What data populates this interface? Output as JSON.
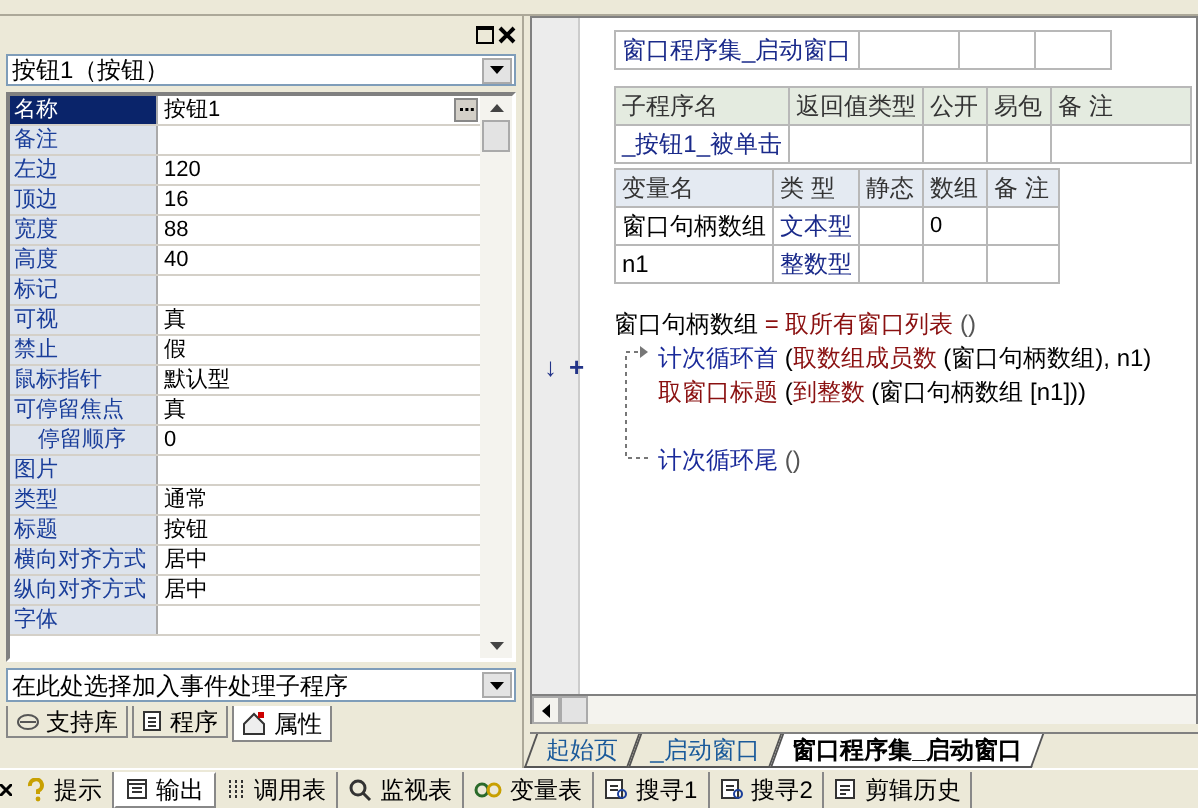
{
  "object_selector": {
    "value": "按钮1（按钮）"
  },
  "properties": [
    {
      "name": "名称",
      "value": "按钮1",
      "selected": true,
      "indented": false
    },
    {
      "name": "备注",
      "selected": false,
      "indented": false
    },
    {
      "name": "左边",
      "value": "120",
      "selected": false,
      "indented": false
    },
    {
      "name": "顶边",
      "value": "16",
      "selected": false,
      "indented": false
    },
    {
      "name": "宽度",
      "value": "88",
      "selected": false,
      "indented": false
    },
    {
      "name": "高度",
      "value": "40",
      "selected": false,
      "indented": false
    },
    {
      "name": "标记",
      "selected": false,
      "indented": false
    },
    {
      "name": "可视",
      "value": "真",
      "selected": false,
      "indented": false
    },
    {
      "name": "禁止",
      "value": "假",
      "selected": false,
      "indented": false
    },
    {
      "name": "鼠标指针",
      "value": "默认型",
      "selected": false,
      "indented": false
    },
    {
      "name": "可停留焦点",
      "value": "真",
      "selected": false,
      "indented": false
    },
    {
      "name": "停留顺序",
      "value": "0",
      "selected": false,
      "indented": true
    },
    {
      "name": "图片",
      "selected": false,
      "indented": false
    },
    {
      "name": "类型",
      "value": "通常",
      "selected": false,
      "indented": false
    },
    {
      "name": "标题",
      "value": "按钮",
      "selected": false,
      "indented": false
    },
    {
      "name": "横向对齐方式",
      "value": "居中",
      "selected": false,
      "indented": false
    },
    {
      "name": "纵向对齐方式",
      "value": "居中",
      "selected": false,
      "indented": false
    },
    {
      "name": "字体",
      "selected": false,
      "indented": false
    }
  ],
  "event_selector": {
    "value": "在此处选择加入事件处理子程序"
  },
  "panel_tabs": [
    {
      "label": "支持库",
      "selected": false
    },
    {
      "label": "程序",
      "selected": false
    },
    {
      "label": "属性",
      "selected": true
    }
  ],
  "assembly_table": {
    "name": "窗口程序集_启动窗口"
  },
  "sub_table": {
    "columns": [
      "子程序名",
      "返回值类型",
      "公开",
      "易包",
      "备 注"
    ],
    "rows": [
      [
        "_按钮1_被单击",
        "",
        "",
        "",
        ""
      ]
    ]
  },
  "var_table": {
    "columns": [
      "变量名",
      "类 型",
      "静态",
      "数组",
      "备 注"
    ],
    "rows": [
      [
        "窗口句柄数组",
        "文本型",
        "",
        "0",
        ""
      ],
      [
        "n1",
        "整数型",
        "",
        "",
        ""
      ]
    ]
  },
  "code_lines": [
    {
      "gap_before": false,
      "segments": [
        {
          "kind": "name",
          "text": "窗口句柄数组"
        },
        {
          "kind": "op",
          "text": " = "
        },
        {
          "kind": "cmd",
          "text": "取所有窗口列表"
        },
        {
          "kind": "num",
          "text": " ()"
        }
      ]
    },
    {
      "gap_before": false,
      "segments": [
        {
          "kind": "flow",
          "text": "计次循环首"
        },
        {
          "kind": "name",
          "text": " ("
        },
        {
          "kind": "cmd",
          "text": "取数组成员数"
        },
        {
          "kind": "name",
          "text": " (窗口句柄数组), n1)"
        }
      ]
    },
    {
      "gap_before": false,
      "segments": [
        {
          "kind": "cmd",
          "text": "取窗口标题"
        },
        {
          "kind": "name",
          "text": " ("
        },
        {
          "kind": "cmd",
          "text": "到整数"
        },
        {
          "kind": "name",
          "text": " (窗口句柄数组 [n1]))"
        }
      ]
    },
    {
      "gap_before": true,
      "segments": [
        {
          "kind": "flow",
          "text": "计次循环尾"
        },
        {
          "kind": "num",
          "text": " ()"
        }
      ]
    }
  ],
  "gutter_marks": [
    "↓",
    "+"
  ],
  "editor_tabs": [
    {
      "label": "起始页",
      "selected": false
    },
    {
      "label": "_启动窗口",
      "selected": false
    },
    {
      "label": "窗口程序集_启动窗口",
      "selected": true
    }
  ],
  "bottom_tabs": [
    {
      "label": "提示",
      "selected": false
    },
    {
      "label": "输出",
      "selected": true
    },
    {
      "label": "调用表",
      "selected": false
    },
    {
      "label": "监视表",
      "selected": false
    },
    {
      "label": "变量表",
      "selected": false
    },
    {
      "label": "搜寻1",
      "selected": false
    },
    {
      "label": "搜寻2",
      "selected": false
    },
    {
      "label": "剪辑历史",
      "selected": false
    }
  ]
}
